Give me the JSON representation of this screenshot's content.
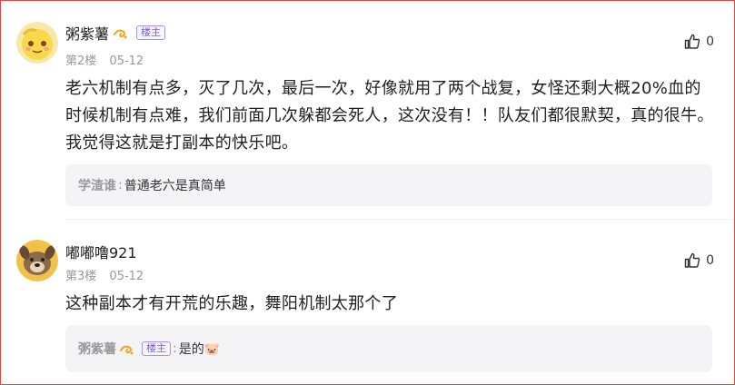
{
  "comments": [
    {
      "username": "粥紫薯",
      "owner_tag": "楼主",
      "floor": "第2楼",
      "date": "05-12",
      "likes": "0",
      "content": "老六机制有点多，灭了几次，最后一次，好像就用了两个战复，女怪还剩大概20%血的时候机制有点难，我们前面几次躲都会死人，这次没有！！队友们都很默契，真的很牛。我觉得这就是打副本的快乐吧。",
      "reply": {
        "username": "学渣谁",
        "separator": ":",
        "text": "普通老六是真简单"
      }
    },
    {
      "username": "嘟嘟噜921",
      "floor": "第3楼",
      "date": "05-12",
      "likes": "0",
      "content": "这种副本才有开荒的乐趣，舞阳机制太那个了",
      "reply": {
        "username": "粥紫薯",
        "owner_tag": "楼主",
        "separator": ":",
        "text": "是的🐷"
      }
    }
  ],
  "colors": {
    "border": "#e0483f",
    "owner_tag": "#7b61c9",
    "reply_bg": "#f4f4f6"
  },
  "icons": {
    "like": "thumbs-up-icon",
    "badge": "swirl-badge-icon"
  }
}
